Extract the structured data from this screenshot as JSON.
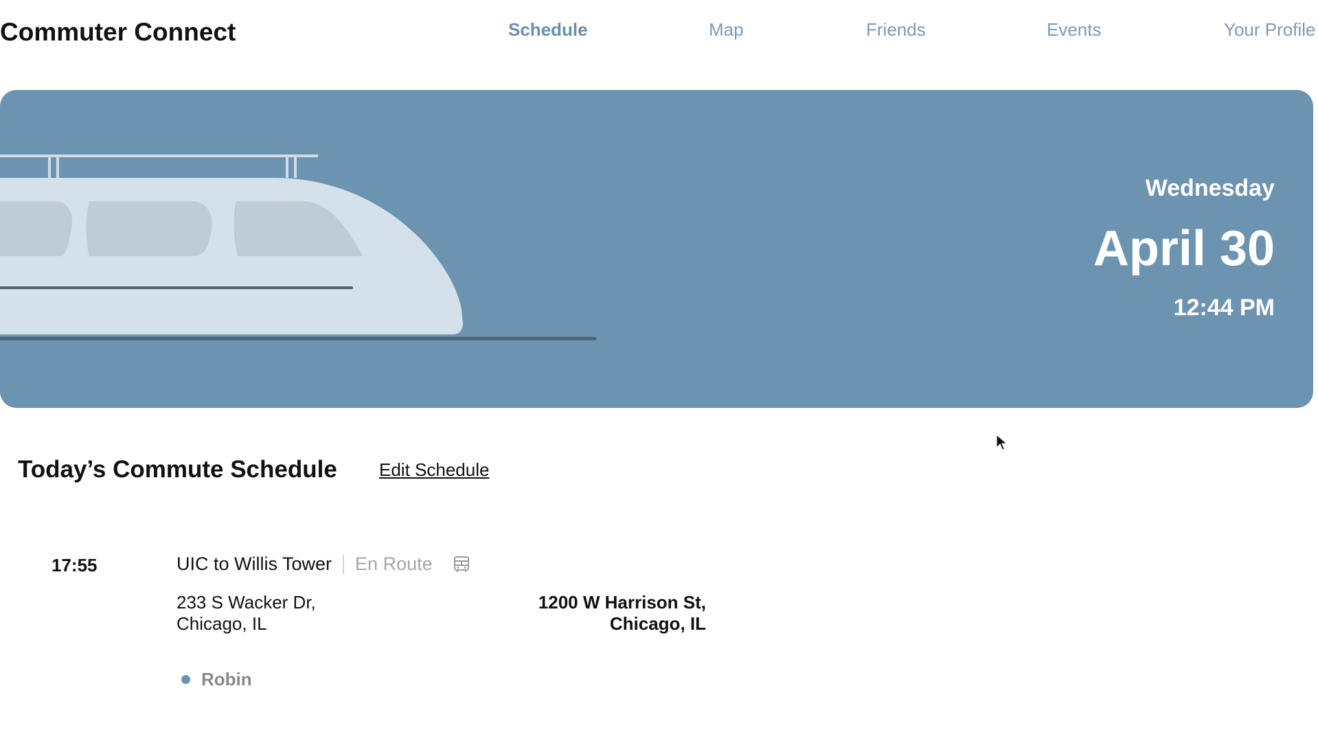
{
  "app": {
    "title": "Commuter Connect"
  },
  "nav": {
    "items": [
      {
        "label": "Schedule",
        "active": true
      },
      {
        "label": "Map",
        "active": false
      },
      {
        "label": "Friends",
        "active": false
      },
      {
        "label": "Events",
        "active": false
      },
      {
        "label": "Your Profile",
        "active": false
      }
    ]
  },
  "hero": {
    "day": "Wednesday",
    "date": "April 30",
    "time": "12:44 PM",
    "background_color": "#6c93b0",
    "illustration": "train-icon"
  },
  "schedule": {
    "title": "Today’s Commute Schedule",
    "edit_label": "Edit Schedule",
    "entries": [
      {
        "time": "17:55",
        "route": "UIC to Willis Tower",
        "status": "En Route",
        "mode_icon": "bus-icon",
        "from_line1": "233 S Wacker Dr,",
        "from_line2": "Chicago, IL",
        "to_line1": "1200 W Harrison St,",
        "to_line2": "Chicago, IL",
        "friend": "Robin"
      }
    ]
  },
  "colors": {
    "accent": "#6c93b0",
    "nav_text": "#7d9ab3",
    "status_text": "#a6a6a6"
  }
}
